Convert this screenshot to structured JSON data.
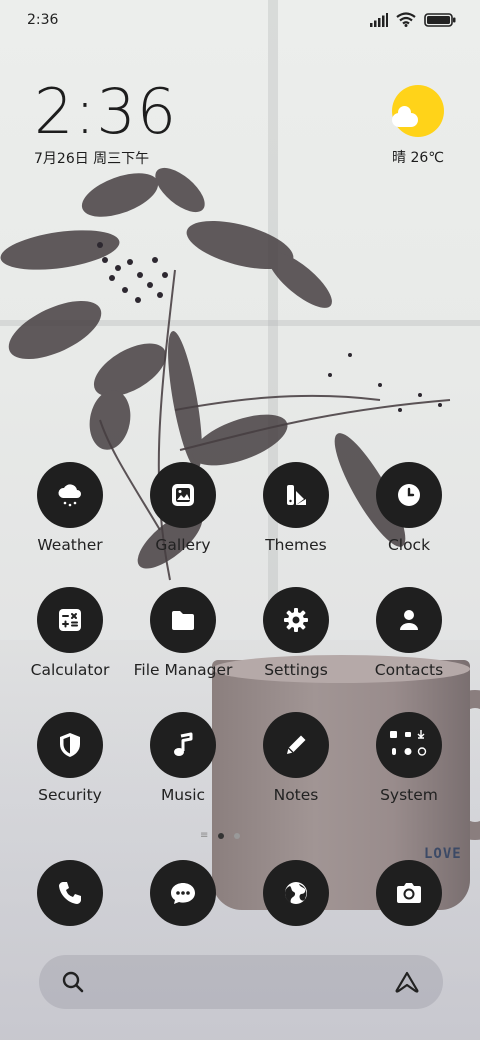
{
  "status_bar": {
    "time": "2:36",
    "icons": [
      "signal-icon",
      "wifi-icon",
      "battery-icon"
    ]
  },
  "clock_widget": {
    "time": "2:36",
    "date": "7月26日 周三下午"
  },
  "weather_widget": {
    "icon": "sun-cloud-icon",
    "text": "晴 26℃"
  },
  "apps": [
    {
      "label": "Weather",
      "icon": "weather-icon"
    },
    {
      "label": "Gallery",
      "icon": "gallery-icon"
    },
    {
      "label": "Themes",
      "icon": "themes-icon"
    },
    {
      "label": "Clock",
      "icon": "clock-icon"
    },
    {
      "label": "Calculator",
      "icon": "calculator-icon"
    },
    {
      "label": "File Manager",
      "icon": "folder-icon"
    },
    {
      "label": "Settings",
      "icon": "gear-icon"
    },
    {
      "label": "Contacts",
      "icon": "person-icon"
    },
    {
      "label": "Security",
      "icon": "shield-icon"
    },
    {
      "label": "Music",
      "icon": "music-note-icon"
    },
    {
      "label": "Notes",
      "icon": "pencil-icon"
    },
    {
      "label": "System",
      "icon": "system-folder-icon"
    }
  ],
  "dock": [
    {
      "icon": "phone-icon"
    },
    {
      "icon": "message-icon"
    },
    {
      "icon": "browser-icon"
    },
    {
      "icon": "camera-icon"
    }
  ],
  "page_indicator": {
    "pages": 2,
    "current": 1
  },
  "search_bar": {
    "left_icon": "search-icon",
    "right_icon": "assistant-icon"
  },
  "wallpaper": {
    "mug_text": "LOVE"
  },
  "colors": {
    "icon_bg": "#1f1f1f",
    "sun": "#ffd319"
  }
}
